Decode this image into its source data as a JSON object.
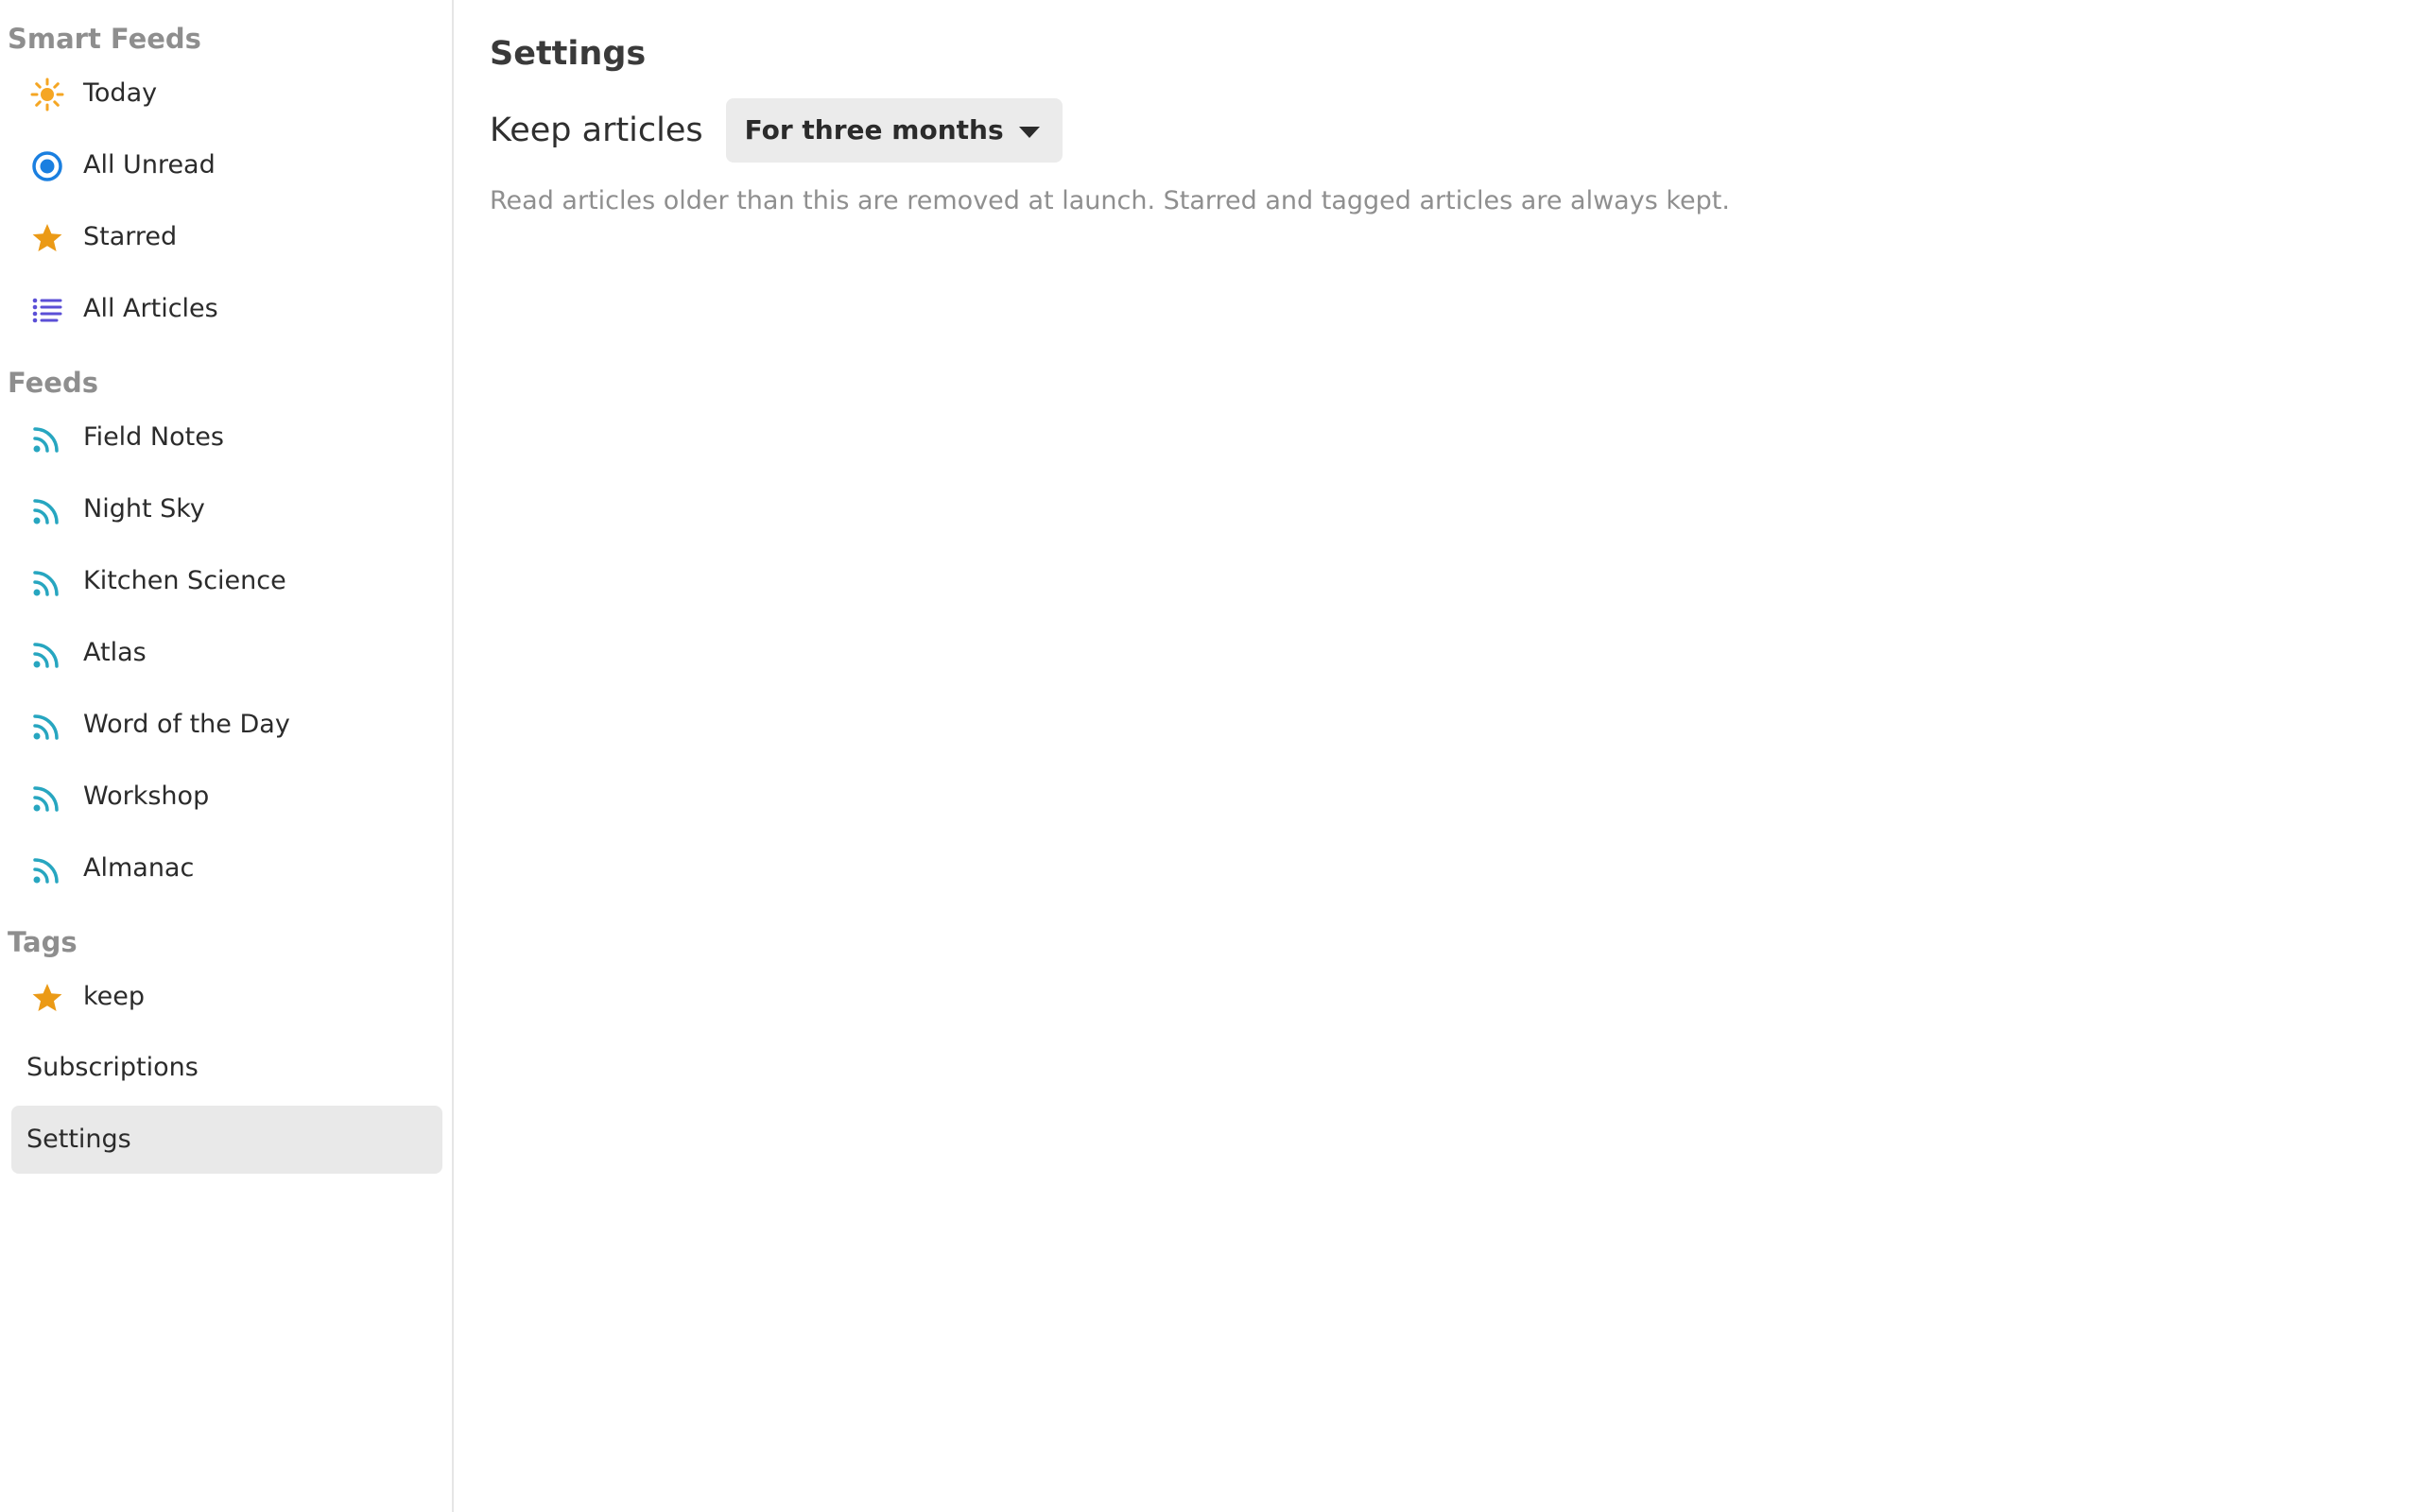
{
  "sidebar": {
    "smart_feeds_header": "Smart Feeds",
    "smart_feeds": [
      {
        "label": "Today",
        "icon": "sun-icon"
      },
      {
        "label": "All Unread",
        "icon": "radio-dot-icon"
      },
      {
        "label": "Starred",
        "icon": "star-icon"
      },
      {
        "label": "All Articles",
        "icon": "list-icon"
      }
    ],
    "feeds_header": "Feeds",
    "feeds": [
      {
        "label": "Field Notes",
        "icon": "rss-icon"
      },
      {
        "label": "Night Sky",
        "icon": "rss-icon"
      },
      {
        "label": "Kitchen Science",
        "icon": "rss-icon"
      },
      {
        "label": "Atlas",
        "icon": "rss-icon"
      },
      {
        "label": "Word of the Day",
        "icon": "rss-icon"
      },
      {
        "label": "Workshop",
        "icon": "rss-icon"
      },
      {
        "label": "Almanac",
        "icon": "rss-icon"
      }
    ],
    "tags_header": "Tags",
    "tags": [
      {
        "label": "keep",
        "icon": "star-icon"
      }
    ],
    "subscriptions_label": "Subscriptions",
    "settings_label": "Settings"
  },
  "main": {
    "title": "Settings",
    "keep_articles_label": "Keep articles",
    "keep_articles_value": "For three months",
    "help_text": "Read articles older than this are removed at launch. Starred and tagged articles are always kept."
  },
  "colors": {
    "sun": "#f5a623",
    "unread": "#1a7fe0",
    "star": "#eb9a16",
    "list": "#5b4fd6",
    "rss": "#27a6c0",
    "selected_bg": "#e9e9e9",
    "header_gray": "#8e8e8e"
  }
}
